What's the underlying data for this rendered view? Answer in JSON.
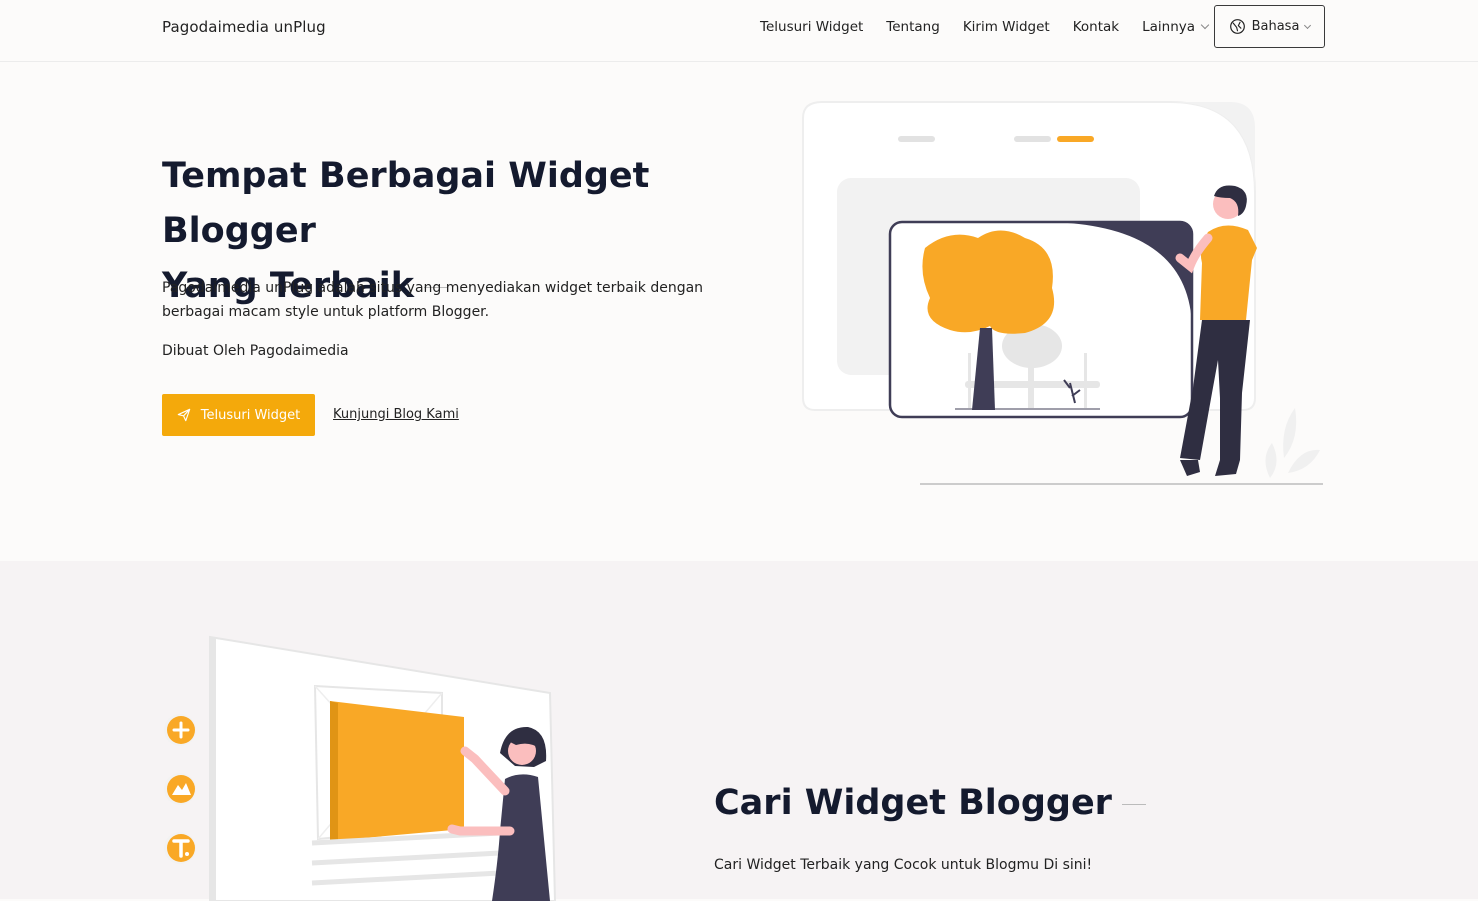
{
  "header": {
    "brand": "Pagodaimedia unPlug",
    "nav": [
      {
        "label": "Telusuri Widget"
      },
      {
        "label": "Tentang"
      },
      {
        "label": "Kirim Widget"
      },
      {
        "label": "Kontak"
      },
      {
        "label": "Lainnya"
      }
    ],
    "language_button": "Bahasa"
  },
  "hero": {
    "title_line1": "Tempat Berbagai Widget Blogger",
    "title_line2": "Yang Terbaik",
    "description": "Pagodaimedia unPlug adalah situs yang menyediakan widget terbaik dengan berbagai macam style untuk platform Blogger.",
    "credit": "Dibuat Oleh Pagodaimedia",
    "primary_button": "Telusuri Widget",
    "secondary_link": "Kunjungi Blog Kami"
  },
  "section2": {
    "title": "Cari Widget Blogger",
    "description": "Cari Widget Terbaik yang Cocok untuk Blogmu Di sini!"
  },
  "colors": {
    "accent": "#f4a90b",
    "illustration_orange": "#f9a826",
    "dark": "#3f3d56",
    "text": "#141a2e"
  },
  "icons": {
    "language": "globe-icon",
    "dropdown": "chevron-down-icon",
    "primary_button": "send-icon",
    "side_icons": [
      "plus-icon",
      "image-icon",
      "text-icon"
    ]
  }
}
